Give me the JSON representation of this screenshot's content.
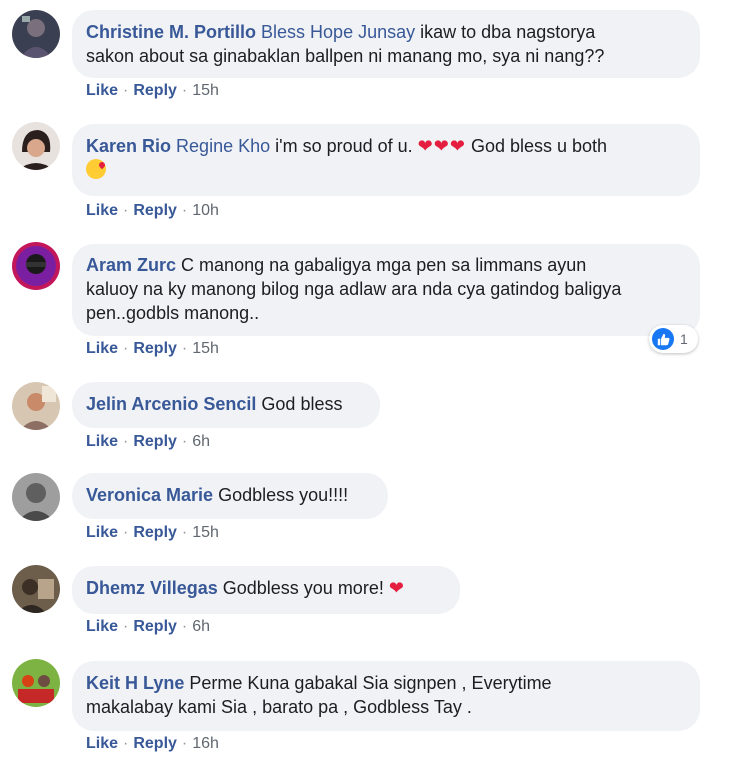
{
  "comments": [
    {
      "author": "Christine M. Portillo",
      "tagged": "Bless Hope Junsay",
      "text_lines": [
        "ikaw to dba nagstorya",
        "sakon about sa ginabaklan ballpen ni manang mo, sya ni nang??"
      ],
      "like": "Like",
      "reply": "Reply",
      "time": "15h"
    },
    {
      "author": "Karen Rio",
      "tagged": "Regine Kho",
      "text": "i'm so proud of u.",
      "text_after": "God bless u both",
      "like": "Like",
      "reply": "Reply",
      "time": "10h"
    },
    {
      "author": "Aram Zurc",
      "text_lines": [
        "C manong na gabaligya mga pen sa limmans ayun",
        "kaluoy na ky manong bilog nga adlaw ara nda cya gatindog baligya",
        "pen..godbls manong.."
      ],
      "like": "Like",
      "reply": "Reply",
      "time": "15h",
      "reaction_count": "1"
    },
    {
      "author": "Jelin Arcenio Sencil",
      "text": "God bless",
      "like": "Like",
      "reply": "Reply",
      "time": "6h"
    },
    {
      "author": "Veronica Marie",
      "text": "Godbless you!!!!",
      "like": "Like",
      "reply": "Reply",
      "time": "15h"
    },
    {
      "author": "Dhemz Villegas",
      "text": "Godbless you more!",
      "like": "Like",
      "reply": "Reply",
      "time": "6h"
    },
    {
      "author": "Keit H Lyne",
      "text_lines": [
        "Perme Kuna gabakal Sia signpen , Everytime",
        "makalabay kami Sia , barato pa , Godbless Tay ."
      ],
      "like": "Like",
      "reply": "Reply",
      "time": "16h"
    }
  ],
  "colors": {
    "author": "#385898",
    "bubble": "#f0f2f5",
    "heart": "#e41e3f",
    "like_badge": "#1877f2"
  }
}
